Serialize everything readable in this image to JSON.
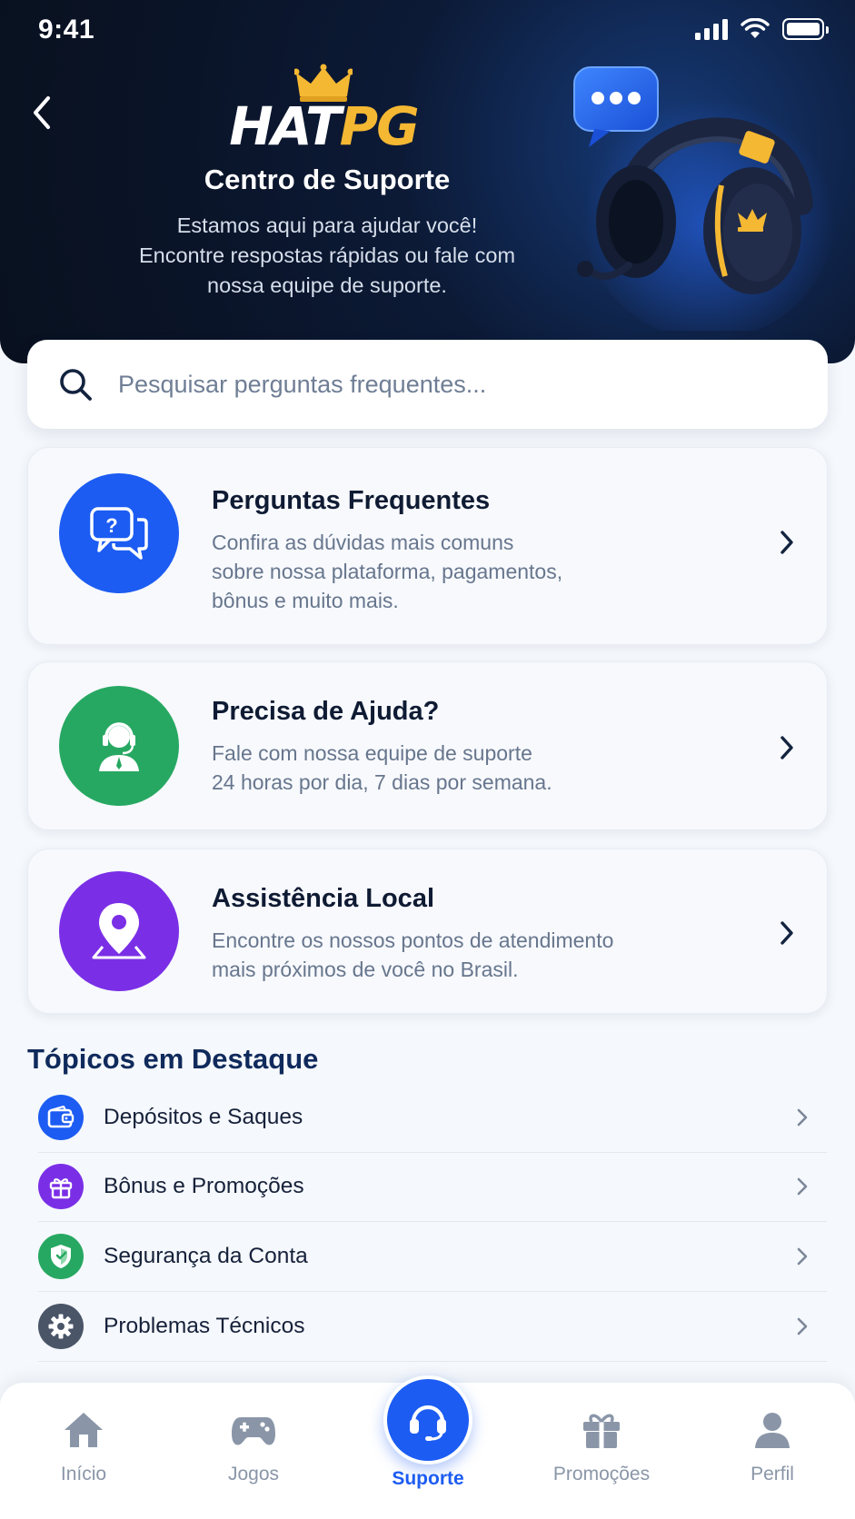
{
  "status_bar": {
    "time": "9:41"
  },
  "header": {
    "logo_part1": "HAT",
    "logo_part2": "PG",
    "title": "Centro de Suporte",
    "subtitle_line1": "Estamos aqui para ajudar você!",
    "subtitle_line2": "Encontre respostas rápidas ou fale com",
    "subtitle_line3": "nossa equipe de suporte."
  },
  "search": {
    "placeholder": "Pesquisar perguntas frequentes..."
  },
  "cards": [
    {
      "title": "Perguntas Frequentes",
      "desc_line1": "Confira as dúvidas mais comuns",
      "desc_line2": "sobre nossa plataforma, pagamentos,",
      "desc_line3": "bônus e muito mais.",
      "icon": "faq-chat-icon",
      "color": "#1c5cf2"
    },
    {
      "title": "Precisa de Ajuda?",
      "desc_line1": "Fale com nossa equipe de suporte",
      "desc_line2": "24 horas por dia, 7 dias por semana.",
      "icon": "support-agent-icon",
      "color": "#27a862"
    },
    {
      "title": "Assistência Local",
      "desc_line1": "Encontre os nossos pontos de atendimento",
      "desc_line2": "mais próximos de você no Brasil.",
      "icon": "location-pin-icon",
      "color": "#7a2fe6"
    }
  ],
  "topics": {
    "title": "Tópicos em Destaque",
    "items": [
      {
        "label": "Depósitos e Saques",
        "icon": "wallet-icon",
        "color": "#1c5cf2"
      },
      {
        "label": "Bônus e Promoções",
        "icon": "gift-icon",
        "color": "#7a2fe6"
      },
      {
        "label": "Segurança da Conta",
        "icon": "shield-icon",
        "color": "#27a862"
      },
      {
        "label": "Problemas Técnicos",
        "icon": "gear-icon",
        "color": "#4a5568"
      }
    ]
  },
  "nav": {
    "items": [
      {
        "label": "Início",
        "icon": "home-icon"
      },
      {
        "label": "Jogos",
        "icon": "gamepad-icon"
      },
      {
        "label": "Suporte",
        "icon": "headset-icon",
        "active": true
      },
      {
        "label": "Promoções",
        "icon": "gift-icon"
      },
      {
        "label": "Perfil",
        "icon": "user-icon"
      }
    ]
  },
  "colors": {
    "accent": "#1c5cf2",
    "gold": "#f5b833",
    "header_bg": "#0a1428"
  }
}
